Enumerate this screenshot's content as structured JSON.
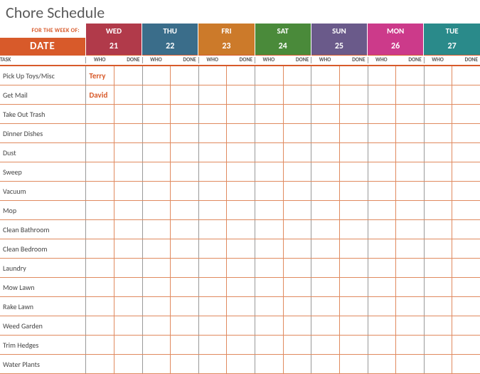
{
  "title": "Chore Schedule",
  "for_week_label": "FOR THE WEEK OF:",
  "date_label": "DATE",
  "task_label": "TASK",
  "who_label": "WHO",
  "done_label": "DONE",
  "days": [
    {
      "name": "WED",
      "num": "21",
      "color": "c-red"
    },
    {
      "name": "THU",
      "num": "22",
      "color": "c-blue"
    },
    {
      "name": "FRI",
      "num": "23",
      "color": "c-orange"
    },
    {
      "name": "SAT",
      "num": "24",
      "color": "c-green"
    },
    {
      "name": "SUN",
      "num": "25",
      "color": "c-purple"
    },
    {
      "name": "MON",
      "num": "26",
      "color": "c-magenta"
    },
    {
      "name": "TUE",
      "num": "27",
      "color": "c-teal"
    }
  ],
  "tasks": [
    {
      "name": "Pick Up Toys/Misc",
      "assignments": [
        "Terry",
        "",
        "",
        "",
        "",
        "",
        ""
      ]
    },
    {
      "name": "Get Mail",
      "assignments": [
        "David",
        "",
        "",
        "",
        "",
        "",
        ""
      ]
    },
    {
      "name": "Take Out Trash",
      "assignments": [
        "",
        "",
        "",
        "",
        "",
        "",
        ""
      ]
    },
    {
      "name": "Dinner Dishes",
      "assignments": [
        "",
        "",
        "",
        "",
        "",
        "",
        ""
      ]
    },
    {
      "name": "Dust",
      "assignments": [
        "",
        "",
        "",
        "",
        "",
        "",
        ""
      ]
    },
    {
      "name": "Sweep",
      "assignments": [
        "",
        "",
        "",
        "",
        "",
        "",
        ""
      ]
    },
    {
      "name": "Vacuum",
      "assignments": [
        "",
        "",
        "",
        "",
        "",
        "",
        ""
      ]
    },
    {
      "name": "Mop",
      "assignments": [
        "",
        "",
        "",
        "",
        "",
        "",
        ""
      ]
    },
    {
      "name": "Clean Bathroom",
      "assignments": [
        "",
        "",
        "",
        "",
        "",
        "",
        ""
      ]
    },
    {
      "name": "Clean Bedroom",
      "assignments": [
        "",
        "",
        "",
        "",
        "",
        "",
        ""
      ]
    },
    {
      "name": "Laundry",
      "assignments": [
        "",
        "",
        "",
        "",
        "",
        "",
        ""
      ]
    },
    {
      "name": "Mow Lawn",
      "assignments": [
        "",
        "",
        "",
        "",
        "",
        "",
        ""
      ]
    },
    {
      "name": "Rake Lawn",
      "assignments": [
        "",
        "",
        "",
        "",
        "",
        "",
        ""
      ]
    },
    {
      "name": "Weed Garden",
      "assignments": [
        "",
        "",
        "",
        "",
        "",
        "",
        ""
      ]
    },
    {
      "name": "Trim Hedges",
      "assignments": [
        "",
        "",
        "",
        "",
        "",
        "",
        ""
      ]
    },
    {
      "name": "Water Plants",
      "assignments": [
        "",
        "",
        "",
        "",
        "",
        "",
        ""
      ]
    }
  ]
}
